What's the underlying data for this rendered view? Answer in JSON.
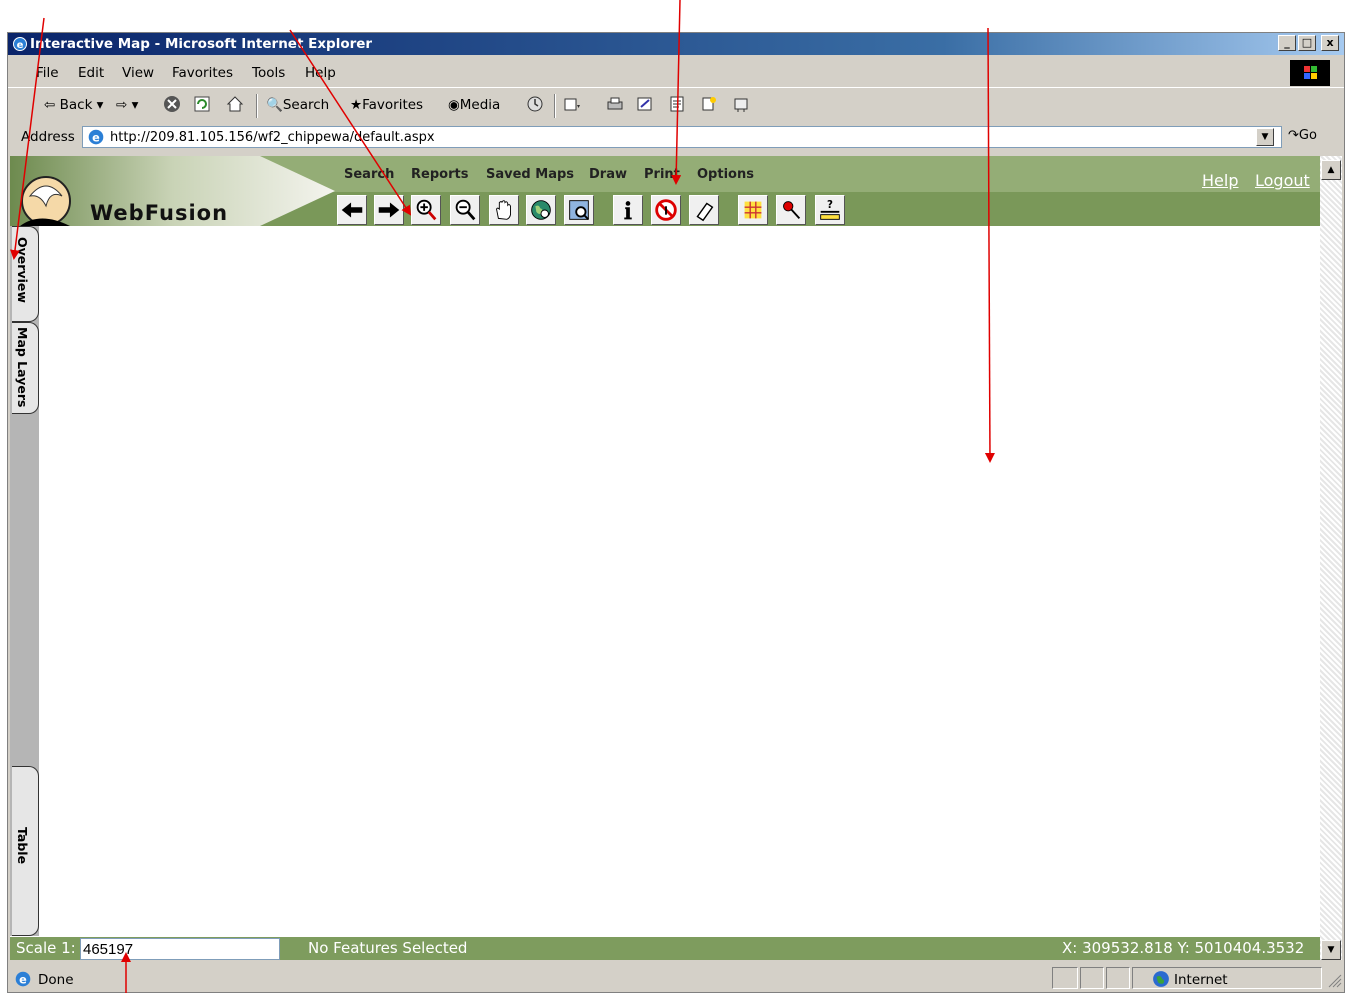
{
  "window": {
    "title": "Interactive Map - Microsoft Internet Explorer",
    "min_glyph": "_",
    "max_glyph": "□",
    "close_glyph": "x"
  },
  "menu": [
    "File",
    "Edit",
    "View",
    "Favorites",
    "Tools",
    "Help"
  ],
  "toolbar": {
    "back": "Back",
    "search": "Search",
    "favorites": "Favorites",
    "media": "Media"
  },
  "address": {
    "label": "Address",
    "url": "http://209.81.105.156/wf2_chippewa/default.aspx",
    "go": "Go"
  },
  "app": {
    "logo": "WebFusion",
    "nav": [
      "Search",
      "Reports",
      "Saved Maps",
      "Draw",
      "Print",
      "Options"
    ],
    "help": "Help",
    "logout": "Logout",
    "tools": [
      "back-arrow-icon",
      "forward-arrow-icon",
      "zoom-in-icon",
      "zoom-out-icon",
      "pan-hand-icon",
      "full-extent-globe-icon",
      "zoom-to-layer-icon",
      "identify-icon",
      "clear-selection-icon",
      "eraser-icon",
      "grid-icon",
      "place-pin-icon",
      "measure-icon"
    ]
  },
  "side_tabs": {
    "overview": "Overview",
    "map_layers": "Map Layers",
    "table": "Table"
  },
  "map_status": {
    "scale_label": "Scale 1:",
    "scale_value": "465197",
    "features": "No Features Selected",
    "coords": "X: 309532.818   Y: 5010404.3532"
  },
  "ie_status": {
    "done": "Done",
    "zone": "Internet"
  },
  "colors": {
    "header_green": "#7e9c5e",
    "title_blue": "#0a246a",
    "arrow_red": "#e00000"
  }
}
